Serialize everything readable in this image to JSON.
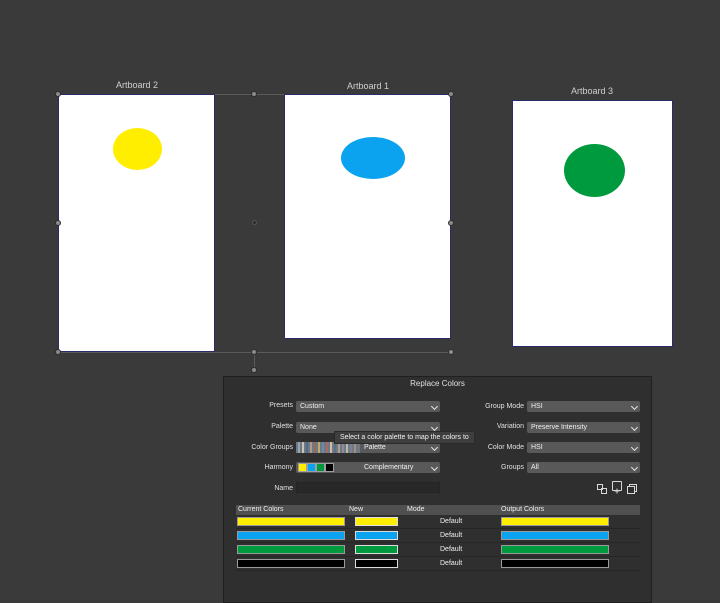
{
  "canvas": {
    "artboards": [
      {
        "title": "Artboard 2",
        "ellipse_color": "#ffee00"
      },
      {
        "title": "Artboard 1",
        "ellipse_color": "#0ba3ef"
      },
      {
        "title": "Artboard 3",
        "ellipse_color": "#009a3e"
      }
    ]
  },
  "dialog": {
    "title": "Replace Colors",
    "left": {
      "presets_label": "Presets",
      "presets_value": "Custom",
      "palette_label": "Palette",
      "palette_value": "None",
      "color_groups_label": "Color Groups",
      "color_groups_value": "Palette",
      "harmony_label": "Harmony",
      "harmony_value": "Complementary",
      "name_label": "Name",
      "name_value": ""
    },
    "right": {
      "group_mode_label": "Group Mode",
      "group_mode_value": "HSI",
      "variation_label": "Variation",
      "variation_value": "Preserve Intensity",
      "color_mode_label": "Color Mode",
      "color_mode_value": "HSI",
      "groups_label": "Groups",
      "groups_value": "All"
    },
    "tooltip": "Select a color palette to map the colors to",
    "table": {
      "headers": [
        "Current Colors",
        "New",
        "Mode",
        "Output Colors"
      ],
      "rows": [
        {
          "current": "#ffee00",
          "new": "#ffee00",
          "mode": "Default",
          "output": "#ffee00"
        },
        {
          "current": "#0ba3ef",
          "new": "#0ba3ef",
          "mode": "Default",
          "output": "#0ba3ef"
        },
        {
          "current": "#009a3e",
          "new": "#009a3e",
          "mode": "Default",
          "output": "#009a3e"
        },
        {
          "current": "#000000",
          "new": "#000000",
          "mode": "Default",
          "output": "#000000"
        }
      ]
    },
    "harmony_swatches": [
      "#ffee00",
      "#0ba3ef",
      "#009a3e",
      "#000000"
    ]
  }
}
